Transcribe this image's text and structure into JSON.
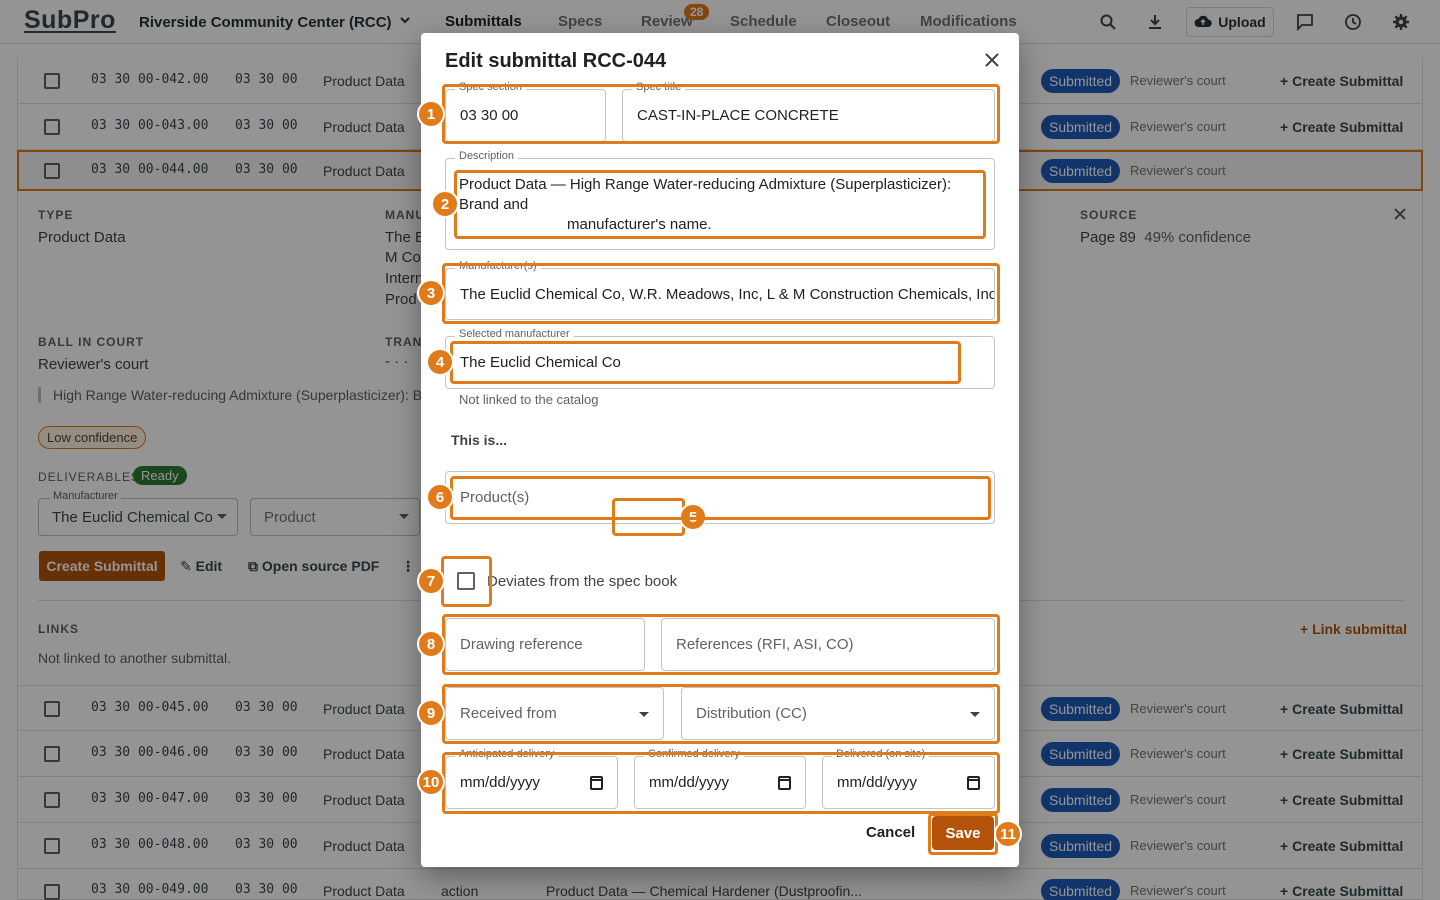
{
  "app": {
    "logo": "SubPro",
    "project": "Riverside Community Center (RCC)"
  },
  "nav": {
    "tabs": [
      {
        "label": "Submittals",
        "active": true
      },
      {
        "label": "Specs"
      },
      {
        "label": "Review",
        "badge": "28"
      },
      {
        "label": "Schedule"
      },
      {
        "label": "Closeout"
      },
      {
        "label": "Modifications"
      }
    ],
    "upload_label": "Upload",
    "icons": [
      "search-icon",
      "download-icon",
      "cloud-upload-icon",
      "comment-icon",
      "history-icon",
      "settings-icon"
    ]
  },
  "rows_top": [
    {
      "number": "03 30 00-042.00",
      "spec": "03 30 00",
      "type": "Product Data",
      "status": "Submitted",
      "court": "Reviewer's court",
      "action": "Create Submittal"
    },
    {
      "number": "03 30 00-043.00",
      "spec": "03 30 00",
      "type": "Product Data",
      "status": "Submitted",
      "court": "Reviewer's court",
      "action": "Create Submittal"
    },
    {
      "number": "03 30 00-044.00",
      "spec": "03 30 00",
      "type": "Product Data",
      "status": "Submitted",
      "court": "Reviewer's court"
    }
  ],
  "detail": {
    "type_label": "TYPE",
    "type_value": "Product Data",
    "manufacturer_label": "MANU",
    "manufacturer_lines": [
      "The E",
      "M Co",
      "Intern",
      "Prod"
    ],
    "source_label": "SOURCE",
    "source_page": "Page 89",
    "source_confidence": "49% confidence",
    "ball_label": "BALL IN COURT",
    "ball_value": "Reviewer's court",
    "tran_label": "TRAN",
    "tran_value": "- · ·",
    "excerpt": "High Range Water-reducing Admixture (Superplasticizer): B",
    "confidence_pill": "Low confidence",
    "deliverables_label": "DELIVERABLES",
    "deliverables_status": "Ready",
    "manufacturer_dd_label": "Manufacturer",
    "manufacturer_dd_value": "The Euclid Chemical Co",
    "product_dd_placeholder": "Product",
    "create_label": "Create Submittal",
    "edit_label": "Edit",
    "open_pdf_label": "Open source PDF",
    "links_label": "LINKS",
    "link_submittal_label": "+ Link submittal",
    "links_empty": "Not linked to another submittal."
  },
  "rows_bottom": [
    {
      "number": "03 30 00-045.00",
      "spec": "03 30 00",
      "type": "Product Data",
      "status": "Submitted",
      "court": "Reviewer's court",
      "action": "Create Submittal"
    },
    {
      "number": "03 30 00-046.00",
      "spec": "03 30 00",
      "type": "Product Data",
      "status": "Submitted",
      "court": "Reviewer's court",
      "action": "Create Submittal"
    },
    {
      "number": "03 30 00-047.00",
      "spec": "03 30 00",
      "type": "Product Data",
      "status": "Submitted",
      "court": "Reviewer's court",
      "action": "Create Submittal"
    },
    {
      "number": "03 30 00-048.00",
      "spec": "03 30 00",
      "type": "Product Data",
      "status": "Submitted",
      "court": "Reviewer's court",
      "action": "Create Submittal"
    },
    {
      "number": "03 30 00-049.00",
      "spec": "03 30 00",
      "type": "Product Data",
      "extra": "action",
      "description": "Product Data — Chemical Hardener (Dustproofin...",
      "status": "Submitted",
      "court": "Reviewer's court",
      "action": "Create Submittal"
    }
  ],
  "modal": {
    "title": "Edit submittal RCC-044",
    "spec_section_label": "Spec section",
    "spec_section_value": "03 30 00",
    "spec_title_label": "Spec title",
    "spec_title_value": "CAST-IN-PLACE CONCRETE",
    "description_label": "Description",
    "description_line1": "Product Data — High Range Water-reducing Admixture (Superplasticizer):",
    "description_line2": "Brand and",
    "description_line3": "manufacturer's name.",
    "manufacturers_label": "Manufacturer(s)",
    "manufacturers_value": "The Euclid Chemical Co, W.R. Meadows, Inc, L & M Construction Chemicals, Inc,",
    "selected_manufacturer_label": "Selected manufacturer",
    "selected_manufacturer_value": "The Euclid Chemical Co",
    "catalog_helper": "Not linked to the catalog",
    "this_is_label": "This is...",
    "product_placeholder": "Product(s)",
    "deviates_label": "Deviates from the spec book",
    "drawing_ref_placeholder": "Drawing reference",
    "references_placeholder": "References (RFI, ASI, CO)",
    "received_from_placeholder": "Received from",
    "distribution_placeholder": "Distribution (CC)",
    "anticipated_label": "Anticipated delivery",
    "confirmed_label": "Confirmed delivery",
    "delivered_label": "Delivered (on site)",
    "date_placeholder": "mm/dd/yyyy",
    "cancel_label": "Cancel",
    "save_label": "Save"
  },
  "annotations": [
    "1",
    "2",
    "3",
    "4",
    "5",
    "6",
    "7",
    "8",
    "9",
    "10",
    "11"
  ],
  "colors": {
    "accent": "#e07b1a",
    "primary": "#b45309",
    "status_blue": "#1e5bb8",
    "ready_green": "#2e7d32"
  }
}
